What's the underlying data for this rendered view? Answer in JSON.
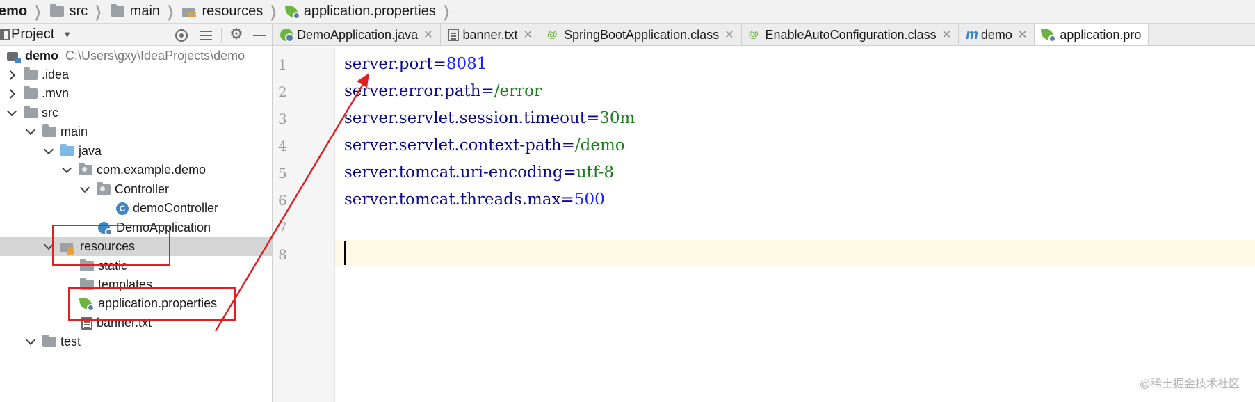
{
  "breadcrumb": [
    "emo",
    "src",
    "main",
    "resources",
    "application.properties"
  ],
  "project_panel": {
    "title": "Project",
    "tree": [
      {
        "label": "demo",
        "path": "C:\\Users\\gxy\\IdeaProjects\\demo"
      },
      {
        "label": ".idea"
      },
      {
        "label": ".mvn"
      },
      {
        "label": "src"
      },
      {
        "label": "main"
      },
      {
        "label": "java"
      },
      {
        "label": "com.example.demo"
      },
      {
        "label": "Controller"
      },
      {
        "label": "demoController"
      },
      {
        "label": "DemoApplication"
      },
      {
        "label": "resources"
      },
      {
        "label": "static"
      },
      {
        "label": "templates"
      },
      {
        "label": "application.properties"
      },
      {
        "label": "banner.txt"
      },
      {
        "label": "test"
      }
    ]
  },
  "tabs": [
    {
      "label": "DemoApplication.java",
      "icon": "spring-class-icon"
    },
    {
      "label": "banner.txt",
      "icon": "text-file-icon"
    },
    {
      "label": "SpringBootApplication.class",
      "icon": "annotation-icon"
    },
    {
      "label": "EnableAutoConfiguration.class",
      "icon": "annotation-icon"
    },
    {
      "label": "demo",
      "icon": "maven-icon"
    },
    {
      "label": "application.pro",
      "icon": "spring-config-icon",
      "active": true
    }
  ],
  "editor": {
    "line_numbers": [
      "1",
      "2",
      "3",
      "4",
      "5",
      "6",
      "7",
      "8"
    ],
    "lines": [
      {
        "key": "server.port",
        "eq": "=",
        "value": "8081"
      },
      {
        "key": "server.error.path",
        "eq": "=",
        "value": "/error"
      },
      {
        "key": "server.servlet.session.timeout",
        "eq": "=",
        "value": "30m"
      },
      {
        "key": "server.servlet.context-path",
        "eq": "=",
        "value": "/demo"
      },
      {
        "key": "server.tomcat.uri-encoding",
        "eq": "=",
        "value": "utf-8"
      },
      {
        "key": "server.tomcat.threads.max",
        "eq": "=",
        "value": "500"
      }
    ],
    "current_line": 8
  },
  "watermark": "@稀土掘金技术社区",
  "colors": {
    "annotation_red": "#e02020",
    "key_blue": "#0a0a8a",
    "value_green": "#1a7f1a",
    "number_blue": "#1a22ff",
    "selection_gray": "#d5d5d5",
    "current_line_bg": "#fdf9e5"
  }
}
